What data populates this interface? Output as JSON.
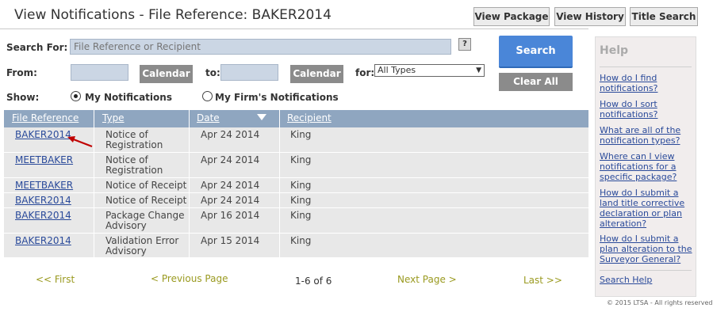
{
  "header": {
    "title": "View Notifications - File Reference: BAKER2014",
    "tabs": [
      "View Package",
      "View History",
      "Title Search"
    ]
  },
  "search": {
    "label": "Search For:",
    "placeholder": "File Reference or Recipient",
    "help_icon": "?",
    "from_label": "From:",
    "to_label": "to:",
    "calendar_label": "Calendar",
    "for_label": "for:",
    "type_selected": "All Types",
    "show_label": "Show:",
    "radio_mine": "My Notifications",
    "radio_firm": "My Firm's Notifications",
    "radio_selected": "mine",
    "search_button": "Search",
    "clear_button": "Clear All"
  },
  "table": {
    "columns": [
      "File Reference",
      "Type",
      "Date",
      "Recipient"
    ],
    "sort_column": "Date",
    "sort_direction": "desc",
    "rows": [
      {
        "ref": "BAKER2014",
        "type": "Notice of Registration",
        "date": "Apr 24 2014",
        "recipient": "King"
      },
      {
        "ref": "MEETBAKER",
        "type": "Notice of Registration",
        "date": "Apr 24 2014",
        "recipient": "King"
      },
      {
        "ref": "MEETBAKER",
        "type": "Notice of Receipt",
        "date": "Apr 24 2014",
        "recipient": "King"
      },
      {
        "ref": "BAKER2014",
        "type": "Notice of Receipt",
        "date": "Apr 24 2014",
        "recipient": "King"
      },
      {
        "ref": "BAKER2014",
        "type": "Package Change Advisory",
        "date": "Apr 16 2014",
        "recipient": "King"
      },
      {
        "ref": "BAKER2014",
        "type": "Validation Error Advisory",
        "date": "Apr 15 2014",
        "recipient": "King"
      }
    ]
  },
  "pager": {
    "first": "<< First",
    "previous": "< Previous Page",
    "count": "1-6 of 6",
    "next": "Next Page >",
    "last": "Last >>"
  },
  "help": {
    "title": "Help",
    "links": [
      "How do I find notifications?",
      "How do I sort notifications?",
      "What are all of the notification types?",
      "Where can I view notifications for a specific package?",
      "How do I submit a land title corrective declaration or plan alteration?",
      "How do I submit a plan alteration to the Surveyor General?"
    ],
    "search_help": "Search Help"
  },
  "footer": {
    "copyright": "© 2015 LTSA - All rights reserved"
  },
  "colors": {
    "table_header": "#8fa6c0",
    "search_button": "#4a86d8",
    "link": "#2a4a9a",
    "pager": "#9a9a20",
    "annotation_arrow": "#c00000"
  }
}
